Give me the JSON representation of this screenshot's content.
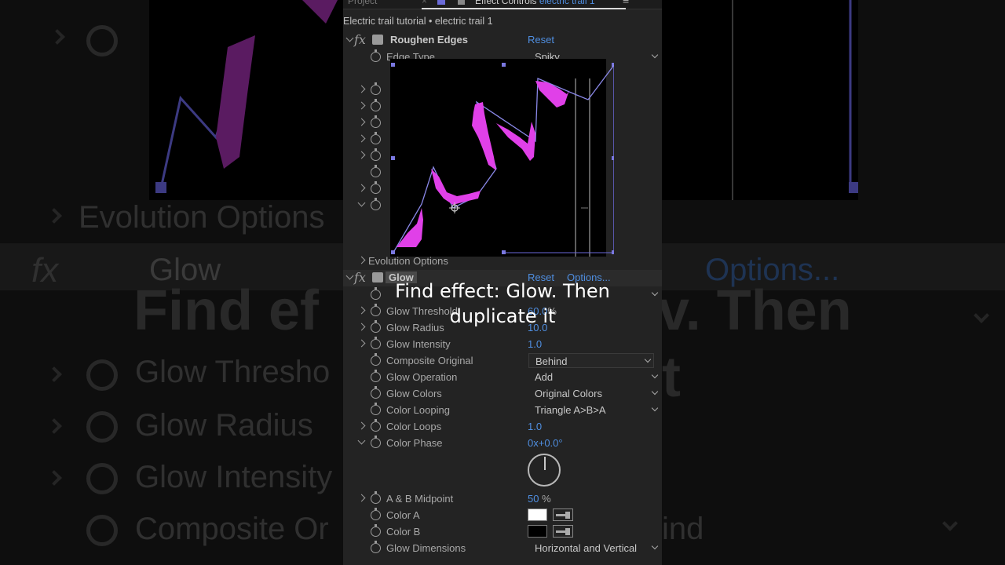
{
  "tabs": {
    "project": "Project",
    "effect_controls": "Effect Controls",
    "layer_name": "electric trail 1"
  },
  "subtitle": "Electric trail tutorial • electric trail 1",
  "roughen": {
    "name": "Roughen Edges",
    "reset": "Reset",
    "edge_type_label": "Edge Type",
    "edge_type_value": "Spiky",
    "evolution_options": "Evolution Options"
  },
  "glow": {
    "name": "Glow",
    "reset": "Reset",
    "options": "Options...",
    "rows": {
      "threshold_label": "Glow Threshold",
      "threshold_value": "60.0",
      "threshold_unit": "%",
      "radius_label": "Glow Radius",
      "radius_value": "10.0",
      "intensity_label": "Glow Intensity",
      "intensity_value": "1.0",
      "composite_label": "Composite Original",
      "composite_value": "Behind",
      "operation_label": "Glow Operation",
      "operation_value": "Add",
      "colors_label": "Glow Colors",
      "colors_value": "Original Colors",
      "looping_label": "Color Looping",
      "looping_value": "Triangle A>B>A",
      "loops_label": "Color Loops",
      "loops_value": "1.0",
      "phase_label": "Color Phase",
      "phase_value_a": "0",
      "phase_value_b": "x+0.0°",
      "midpoint_label": "A & B Midpoint",
      "midpoint_value": "50",
      "midpoint_unit": "%",
      "color_a_label": "Color A",
      "color_b_label": "Color B",
      "dimensions_label": "Glow Dimensions",
      "dimensions_value": "Horizontal and Vertical"
    }
  },
  "caption": {
    "line1": "Find effect: Glow. Then",
    "line2": "duplicate it"
  },
  "background_text": {
    "evolution": "Evolution Options",
    "glow": "Glow",
    "options": "Options...",
    "caption_left": "Find ef",
    "caption_right": "v. Then",
    "row1": "Glow Thresho",
    "row2": "Glow Radius",
    "row3": "Glow Intensity",
    "row4": "Composite Or",
    "right_row": "ind",
    "right_big": "t"
  },
  "colors": {
    "accent_blue": "#4f8ee0",
    "trail_magenta": "#e040e8",
    "path_blue": "#7a78e0",
    "color_a": "#ffffff",
    "color_b": "#000000"
  }
}
